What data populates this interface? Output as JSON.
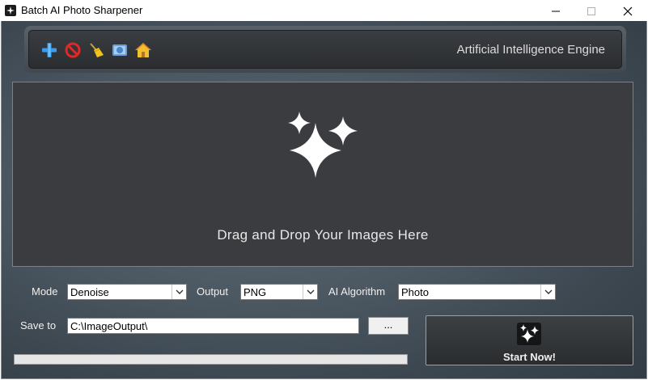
{
  "window": {
    "title": "Batch AI Photo Sharpener",
    "icons": [
      "app-icon",
      "minimize-icon",
      "maximize-icon",
      "close-icon"
    ]
  },
  "toolbar": {
    "icons": [
      "add-icon",
      "remove-icon",
      "clear-broom-icon",
      "website-icon",
      "home-icon"
    ],
    "engine_label": "Artificial Intelligence Engine"
  },
  "dropzone": {
    "icon": "sparkles-icon",
    "text": "Drag and Drop Your Images Here"
  },
  "options": {
    "mode_label": "Mode",
    "mode_value": "Denoise",
    "output_label": "Output",
    "output_value": "PNG",
    "algorithm_label": "AI Algorithm",
    "algorithm_value": "Photo"
  },
  "save": {
    "label": "Save to",
    "path": "C:\\ImageOutput\\",
    "browse_label": "..."
  },
  "progress": {
    "value": 0
  },
  "start": {
    "label": "Start Now!",
    "icon": "sparkles-icon"
  },
  "colors": {
    "accent_blue": "#2f8fe8",
    "progress_green": "#06b025",
    "panel_dark": "#3a3c3f"
  }
}
